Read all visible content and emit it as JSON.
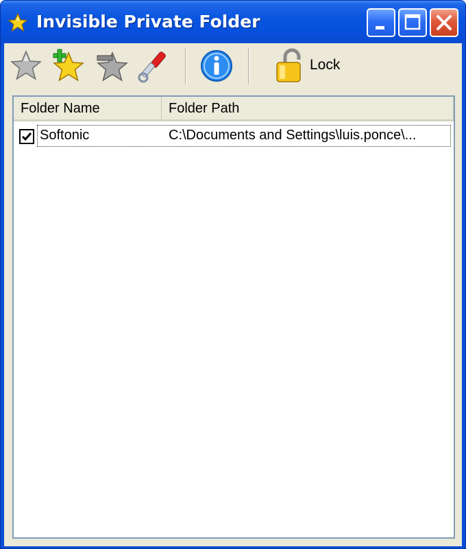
{
  "window": {
    "title": "Invisible Private Folder",
    "title_icon": "star-icon",
    "controls": [
      "minimize-icon",
      "maximize-icon",
      "close-icon"
    ]
  },
  "toolbar": {
    "items": [
      {
        "icon": "star-icon"
      },
      {
        "icon": "add-star-icon"
      },
      {
        "icon": "remove-star-icon"
      },
      {
        "icon": "wrench-icon"
      },
      {
        "icon": "info-icon"
      },
      {
        "icon": "lock-icon",
        "label": "Lock"
      }
    ]
  },
  "list": {
    "columns": [
      "Folder Name",
      "Folder Path"
    ],
    "rows": [
      {
        "checked": true,
        "name": "Softonic",
        "path": "C:\\Documents and Settings\\luis.ponce\\..."
      }
    ]
  },
  "colors": {
    "titlebar": "#0a56df",
    "face": "#ece9d8",
    "list_border": "#7f9db9",
    "close_button": "#e0583a"
  }
}
